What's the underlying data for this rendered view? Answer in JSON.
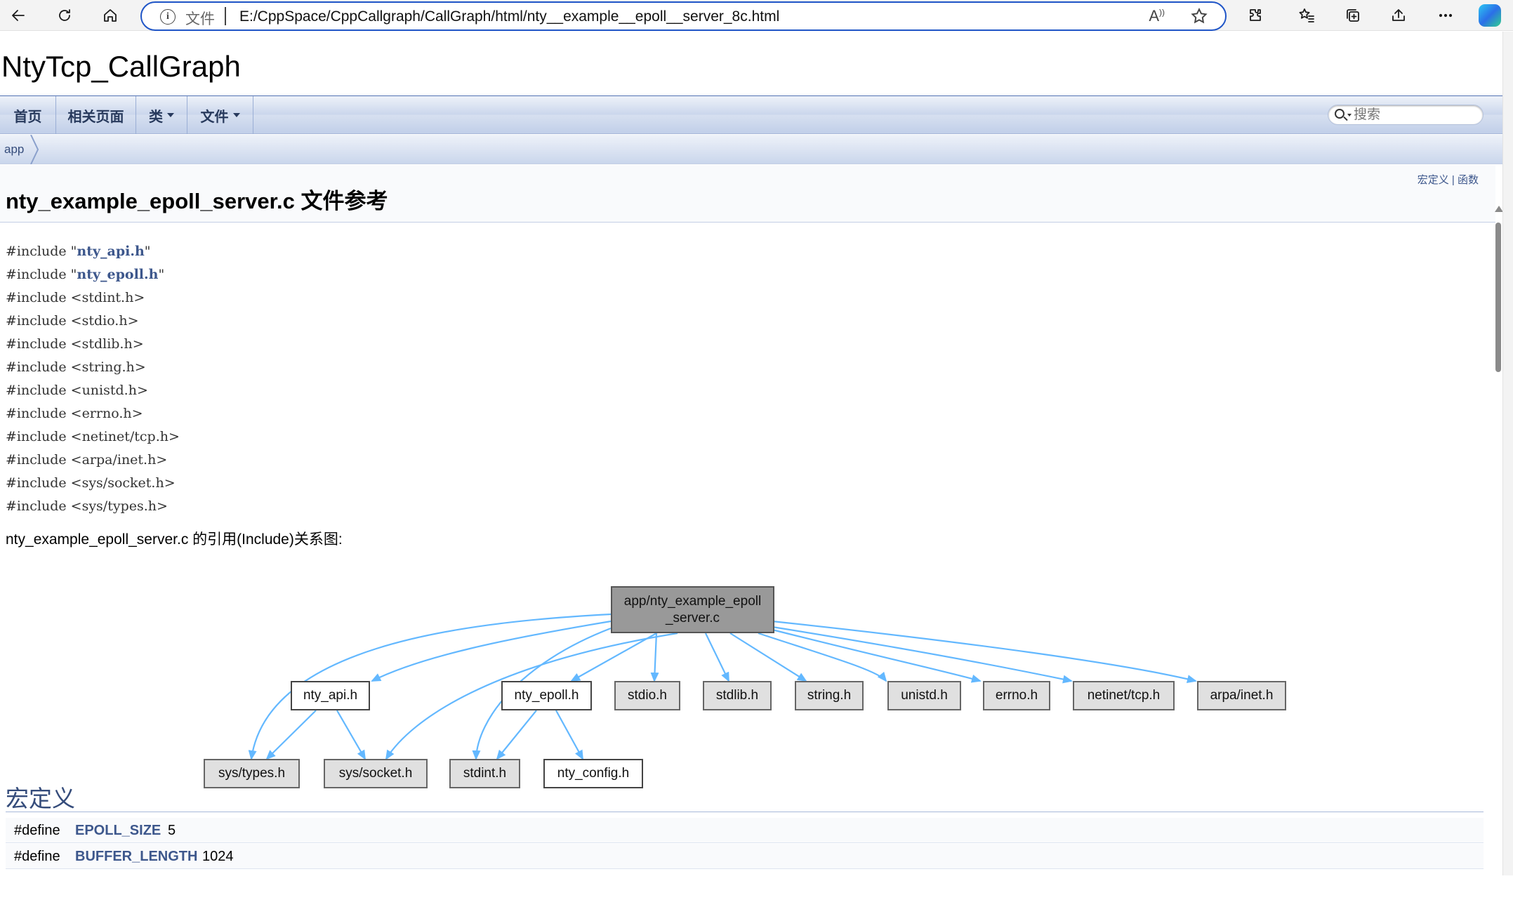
{
  "browser": {
    "scheme_label": "文件",
    "url": "E:/CppSpace/CppCallgraph/CallGraph/html/nty__example__epoll__server_8c.html",
    "read_aloud_label": "A̩"
  },
  "project": {
    "name": "NtyTcp_CallGraph"
  },
  "navbar": {
    "items": [
      {
        "label": "首页"
      },
      {
        "label": "相关页面"
      },
      {
        "label": "类"
      },
      {
        "label": "文件"
      }
    ],
    "search_placeholder": "搜索"
  },
  "breadcrumb": {
    "items": [
      "app"
    ]
  },
  "header": {
    "summary_macros": "宏定义",
    "summary_sep": " | ",
    "summary_functions": "函数",
    "title": "nty_example_epoll_server.c 文件参考"
  },
  "includes": [
    {
      "prefix": "#include ",
      "open": "\"",
      "name": "nty_api.h",
      "close": "\"",
      "link": true
    },
    {
      "prefix": "#include ",
      "open": "\"",
      "name": "nty_epoll.h",
      "close": "\"",
      "link": true
    },
    {
      "prefix": "#include ",
      "open": "<",
      "name": "stdint.h",
      "close": ">",
      "link": false
    },
    {
      "prefix": "#include ",
      "open": "<",
      "name": "stdio.h",
      "close": ">",
      "link": false
    },
    {
      "prefix": "#include ",
      "open": "<",
      "name": "stdlib.h",
      "close": ">",
      "link": false
    },
    {
      "prefix": "#include ",
      "open": "<",
      "name": "string.h",
      "close": ">",
      "link": false
    },
    {
      "prefix": "#include ",
      "open": "<",
      "name": "unistd.h",
      "close": ">",
      "link": false
    },
    {
      "prefix": "#include ",
      "open": "<",
      "name": "errno.h",
      "close": ">",
      "link": false
    },
    {
      "prefix": "#include ",
      "open": "<",
      "name": "netinet/tcp.h",
      "close": ">",
      "link": false
    },
    {
      "prefix": "#include ",
      "open": "<",
      "name": "arpa/inet.h",
      "close": ">",
      "link": false
    },
    {
      "prefix": "#include ",
      "open": "<",
      "name": "sys/socket.h",
      "close": ">",
      "link": false
    },
    {
      "prefix": "#include ",
      "open": "<",
      "name": "sys/types.h",
      "close": ">",
      "link": false
    }
  ],
  "graph": {
    "caption": "nty_example_epoll_server.c 的引用(Include)关系图:",
    "root": {
      "line1": "app/nty_example_epoll",
      "line2": "_server.c"
    },
    "nodes": {
      "nty_api": "nty_api.h",
      "nty_epoll": "nty_epoll.h",
      "stdio": "stdio.h",
      "stdlib": "stdlib.h",
      "string": "string.h",
      "unistd": "unistd.h",
      "errno": "errno.h",
      "netinet": "netinet/tcp.h",
      "arpa": "arpa/inet.h",
      "systypes": "sys/types.h",
      "syssocket": "sys/socket.h",
      "stdint": "stdint.h",
      "nty_config": "nty_config.h"
    },
    "edge_color": "#63b8ff"
  },
  "macros": {
    "heading": "宏定义",
    "rows": [
      {
        "keyword": "#define",
        "name": "EPOLL_SIZE",
        "value": "5"
      },
      {
        "keyword": "#define",
        "name": "BUFFER_LENGTH",
        "value": "1024"
      }
    ]
  }
}
